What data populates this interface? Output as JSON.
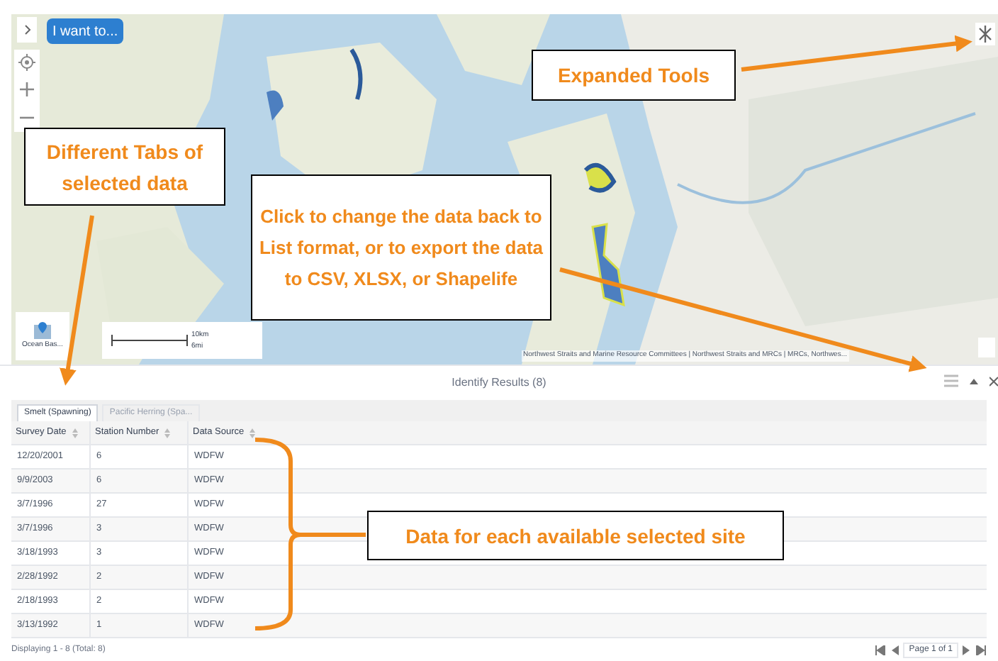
{
  "map": {
    "menu_button": "I want to...",
    "basemap_label": "Ocean Bas...",
    "scale": {
      "metric": "10km",
      "imperial": "6mi"
    },
    "attribution": "Northwest Straits and Marine Resource Committees | Northwest Straits and MRCs | MRCs, Northwes..."
  },
  "results": {
    "title": "Identify Results (8)",
    "tabs": [
      {
        "label": "Smelt (Spawning)",
        "selected": true
      },
      {
        "label": "Pacific Herring (Spa...",
        "selected": false
      }
    ],
    "columns": [
      "Survey Date",
      "Station Number",
      "Data Source"
    ],
    "rows": [
      [
        "12/20/2001",
        "6",
        "WDFW"
      ],
      [
        "9/9/2003",
        "6",
        "WDFW"
      ],
      [
        "3/7/1996",
        "27",
        "WDFW"
      ],
      [
        "3/7/1996",
        "3",
        "WDFW"
      ],
      [
        "3/18/1993",
        "3",
        "WDFW"
      ],
      [
        "2/28/1992",
        "2",
        "WDFW"
      ],
      [
        "2/18/1993",
        "2",
        "WDFW"
      ],
      [
        "3/13/1992",
        "1",
        "WDFW"
      ]
    ],
    "status": "Displaying 1 - 8 (Total: 8)",
    "page": "Page 1 of 1"
  },
  "annotations": [
    {
      "kind": "callout",
      "text": "Expanded Tools"
    },
    {
      "kind": "callout",
      "text": "Different Tabs of selected data"
    },
    {
      "kind": "callout",
      "text": "Click to change the data back to List format, or to export the data to CSV, XLSX, or Shapelife"
    },
    {
      "kind": "callout",
      "text": "Data for each available selected site"
    }
  ]
}
